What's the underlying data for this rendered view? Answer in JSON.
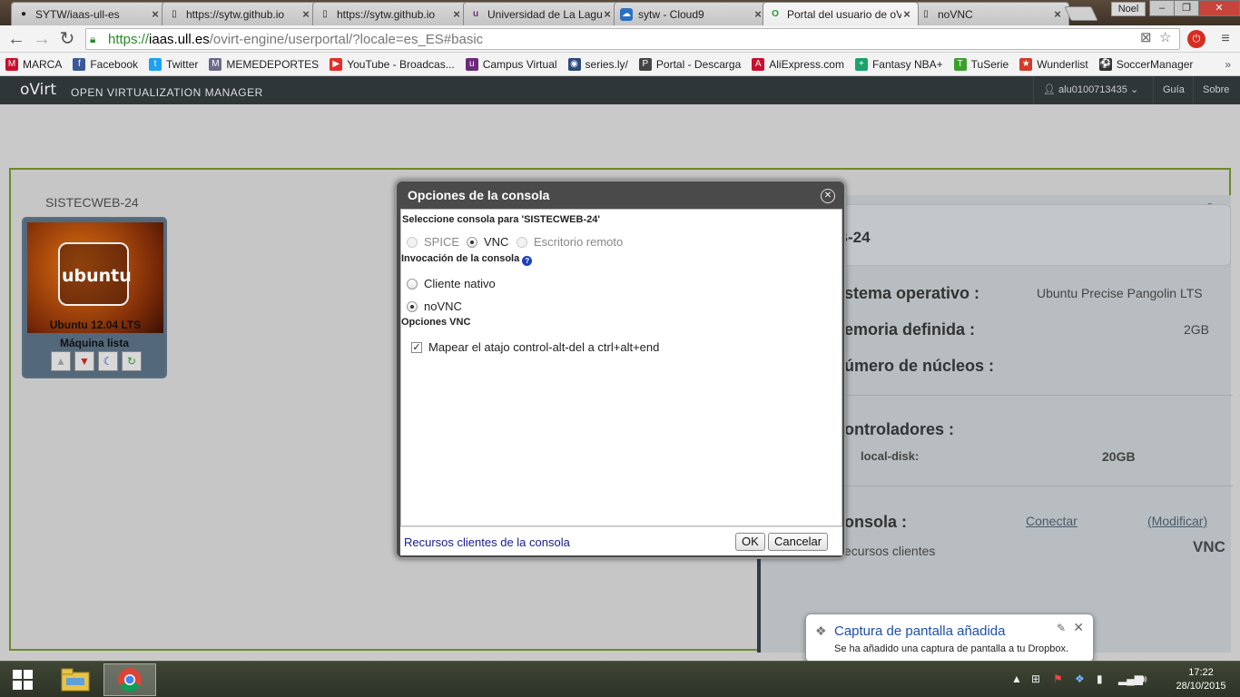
{
  "browser": {
    "tabs": [
      {
        "title": "SYTW/iaas-ull-es",
        "favicon": "github-icon",
        "active": false
      },
      {
        "title": "https://sytw.github.io",
        "favicon": "page-icon",
        "active": false
      },
      {
        "title": "https://sytw.github.io",
        "favicon": "page-icon",
        "active": false
      },
      {
        "title": "Universidad de La Laguna",
        "favicon": "ull-icon",
        "active": false
      },
      {
        "title": "sytw - Cloud9",
        "favicon": "cloud9-icon",
        "active": false
      },
      {
        "title": "Portal del usuario de oVirt",
        "favicon": "ovirt-icon",
        "active": true
      },
      {
        "title": "noVNC",
        "favicon": "page-icon",
        "active": false
      }
    ],
    "user_badge": "Noel",
    "url": {
      "scheme": "https://",
      "host": "iaas.ull.es",
      "path": "/ovirt-engine/userportal/?locale=es_ES#basic"
    },
    "bookmarks": [
      {
        "label": "MARCA",
        "color": "#c8102e",
        "glyph": "M"
      },
      {
        "label": "Facebook",
        "color": "#3b5998",
        "glyph": "f"
      },
      {
        "label": "Twitter",
        "color": "#1da1f2",
        "glyph": "t"
      },
      {
        "label": "MEMEDEPORTES",
        "color": "#6a6a8a",
        "glyph": "M"
      },
      {
        "label": "YouTube - Broadcas...",
        "color": "#e52d27",
        "glyph": "▶"
      },
      {
        "label": "Campus Virtual",
        "color": "#6b2a7a",
        "glyph": "u"
      },
      {
        "label": "series.ly/",
        "color": "#2a4a7a",
        "glyph": "◉"
      },
      {
        "label": "Portal - Descarga",
        "color": "#444",
        "glyph": "P"
      },
      {
        "label": "AliExpress.com",
        "color": "#c8102e",
        "glyph": "A"
      },
      {
        "label": "Fantasy NBA+",
        "color": "#1aa36b",
        "glyph": "+"
      },
      {
        "label": "TuSerie",
        "color": "#3aa02a",
        "glyph": "T"
      },
      {
        "label": "Wunderlist",
        "color": "#d43a2a",
        "glyph": "★"
      },
      {
        "label": "SoccerManager",
        "color": "#333",
        "glyph": "⚽"
      }
    ]
  },
  "ovirt": {
    "logo": "oVirt",
    "product": "OPEN VIRTUALIZATION MANAGER",
    "user": "alu0100713435",
    "guide": "Guía",
    "about": "Sobre"
  },
  "vm": {
    "name": "SISTECWEB-24",
    "brand": "ubuntu",
    "os_label": "Ubuntu 12.04 LTS",
    "status": "Máquina lista"
  },
  "details": {
    "title": "STECWEB-24",
    "os_label": "stema operativo :",
    "os_value": "Ubuntu Precise Pangolin LTS",
    "memory_label": "emoria definida :",
    "memory_value": "2GB",
    "cores_label": "úmero de núcleos :",
    "drives_label": "ontroladores :",
    "disk_name": "local-disk:",
    "disk_size": "20GB",
    "console_label": "onsola :",
    "connect": "Conectar",
    "modify": "(Modificar)",
    "resources": "ecursos clientes",
    "protocol": "VNC"
  },
  "modal": {
    "title": "Opciones de la consola",
    "select_label": "Seleccione consola para 'SISTECWEB-24'",
    "protocols": [
      {
        "label": "SPICE",
        "checked": false,
        "disabled": true
      },
      {
        "label": "VNC",
        "checked": true,
        "disabled": false
      },
      {
        "label": "Escritorio remoto",
        "checked": false,
        "disabled": true
      }
    ],
    "invocation_label": "Invocación de la consola",
    "invocations": [
      {
        "label": "Cliente nativo",
        "checked": false
      },
      {
        "label": "noVNC",
        "checked": true
      }
    ],
    "vnc_options_label": "Opciones VNC",
    "ctrl_alt_del": {
      "label": "Mapear el atajo control-alt-del a ctrl+alt+end",
      "checked": true
    },
    "footer_link": "Recursos clientes de la consola",
    "ok": "OK",
    "cancel": "Cancelar"
  },
  "toast": {
    "title": "Captura de pantalla añadida",
    "message": "Se ha añadido una captura de pantalla a tu Dropbox."
  },
  "taskbar": {
    "time": "17:22",
    "date": "28/10/2015"
  }
}
